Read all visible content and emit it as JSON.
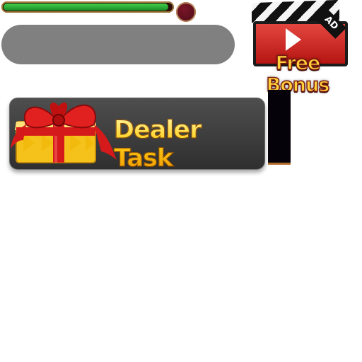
{
  "hud": {
    "progress_fraction": 0.98,
    "progress_color": "#2bb339"
  },
  "free_bonus": {
    "label": "Free Bonus",
    "ad_tag": "AD",
    "icon": "clapperboard-play-icon"
  },
  "dealer_task": {
    "label": "Dealer Task",
    "icon": "gift-box-icon",
    "text_color": "#ffc21a"
  }
}
